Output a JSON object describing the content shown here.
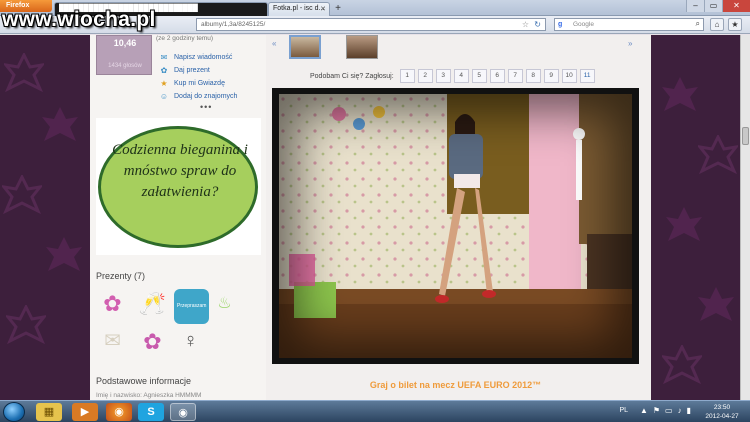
{
  "watermark": "www.wiocha.pl",
  "browser": {
    "menu_label": "Firefox",
    "tabs": [
      {
        "label": "████████████████████████████"
      },
      {
        "label": "Fotka.pl - isc d..."
      }
    ],
    "new_tab": "+",
    "url": "albumy/1,3a/8245125/",
    "search_placeholder": "Google",
    "search_engine_letter": "g"
  },
  "profile": {
    "rating_value": "10,46",
    "rating_caption": "1434 głosów",
    "time_note": "(ze 2 godziny temu)",
    "actions": [
      {
        "icon": "mail-icon",
        "glyph": "✉",
        "label": "Napisz wiadomość"
      },
      {
        "icon": "gift-icon",
        "glyph": "✿",
        "label": "Daj prezent"
      },
      {
        "icon": "star-icon",
        "glyph": "★",
        "label": "Kup mi Gwiazdę"
      },
      {
        "icon": "add-friend-icon",
        "glyph": "☺",
        "label": "Dodaj do znajomych"
      }
    ],
    "more": "•••"
  },
  "promo": {
    "text": "Codzienna bieganina i mnóstwo spraw do załatwienia?"
  },
  "gifts_section": {
    "title": "Prezenty (7)",
    "przepraszam_label": "Przepraszam"
  },
  "basic_info": {
    "title": "Podstawowe informacje",
    "first_row": "Imię i nazwisko:  Agnieszka HMMMM"
  },
  "voting": {
    "label": "Podobam Ci się? Zagłosuj:",
    "buttons": [
      "1",
      "2",
      "3",
      "4",
      "5",
      "6",
      "7",
      "8",
      "9",
      "10",
      "11"
    ]
  },
  "euro_link": "Graj o bilet na mecz UEFA EURO 2012™",
  "taskbar": {
    "lang": "PL",
    "time": "23:50",
    "date": "2012-04-27"
  },
  "colors": {
    "page_bg": "#3d1f3c",
    "accent_orange": "#ef9b3b",
    "link_blue": "#2b62a8",
    "promo_green": "#a6cf5d"
  }
}
